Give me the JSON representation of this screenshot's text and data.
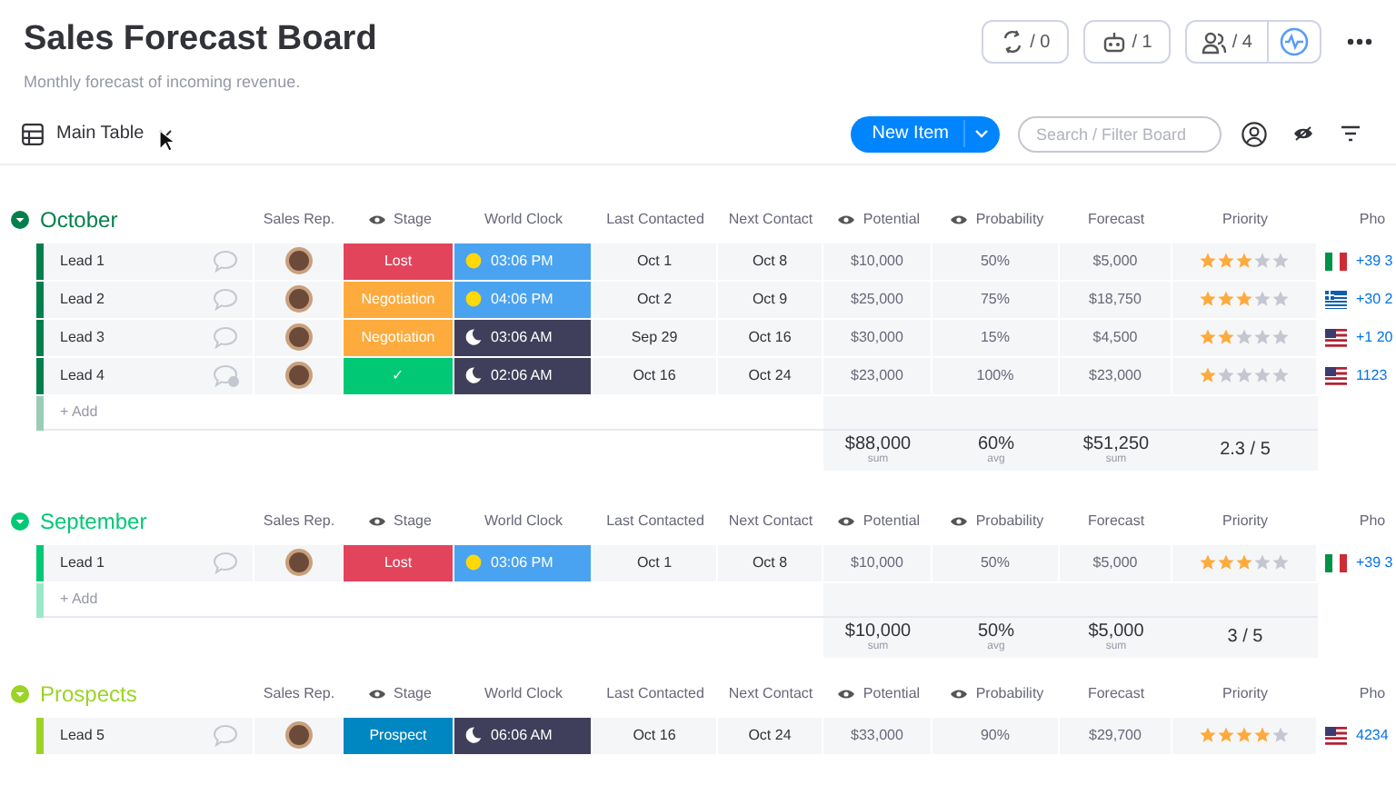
{
  "board": {
    "title": "Sales Forecast Board",
    "description": "Monthly forecast of incoming revenue."
  },
  "header_buttons": [
    {
      "kind": "automations",
      "label": "/ 0"
    },
    {
      "kind": "integrations",
      "label": "/ 1"
    },
    {
      "kind": "members",
      "label": "/ 4"
    }
  ],
  "view": {
    "label": "Main Table"
  },
  "new_item": {
    "label": "New Item"
  },
  "search": {
    "placeholder": "Search / Filter Board"
  },
  "groups": [
    {
      "title": "October",
      "color": "#037f4c",
      "add_label": "+ Add",
      "columns": [
        {
          "label": "Sales Rep.",
          "eye": false
        },
        {
          "label": "Stage",
          "eye": true
        },
        {
          "label": "World Clock",
          "eye": false
        },
        {
          "label": "Last Contacted",
          "eye": false
        },
        {
          "label": "Next Contact",
          "eye": false
        },
        {
          "label": "Potential",
          "eye": true
        },
        {
          "label": "Probability",
          "eye": true
        },
        {
          "label": "Forecast",
          "eye": false
        },
        {
          "label": "Priority",
          "eye": false
        },
        {
          "label": "Pho",
          "eye": false
        }
      ],
      "rows": [
        {
          "name": "Lead 1",
          "has_updates": false,
          "stage": {
            "label": "Lost",
            "color": "#e2445c"
          },
          "clock": {
            "kind": "day",
            "time": "03:06 PM"
          },
          "last_contacted": "Oct 1",
          "next_contact": "Oct 8",
          "potential": "$10,000",
          "probability": "50%",
          "forecast": "$5,000",
          "stars": 3,
          "phone": {
            "kind": "italy",
            "number": "+39 3"
          }
        },
        {
          "name": "Lead 2",
          "has_updates": false,
          "stage": {
            "label": "Negotiation",
            "color": "#fdab3d"
          },
          "clock": {
            "kind": "day",
            "time": "04:06 PM"
          },
          "last_contacted": "Oct 2",
          "next_contact": "Oct 9",
          "potential": "$25,000",
          "probability": "75%",
          "forecast": "$18,750",
          "stars": 3,
          "phone": {
            "kind": "greece",
            "number": "+30 2"
          }
        },
        {
          "name": "Lead 3",
          "has_updates": false,
          "stage": {
            "label": "Negotiation",
            "color": "#fdab3d"
          },
          "clock": {
            "kind": "night",
            "time": "03:06 AM"
          },
          "last_contacted": "Sep 29",
          "next_contact": "Oct 16",
          "potential": "$30,000",
          "probability": "15%",
          "forecast": "$4,500",
          "stars": 2,
          "phone": {
            "kind": "us",
            "number": "+1 20"
          }
        },
        {
          "name": "Lead 4",
          "has_updates": true,
          "stage": {
            "label": "✓",
            "color": "#00c875"
          },
          "clock": {
            "kind": "night",
            "time": "02:06 AM"
          },
          "last_contacted": "Oct 16",
          "next_contact": "Oct 24",
          "potential": "$23,000",
          "probability": "100%",
          "forecast": "$23,000",
          "stars": 1,
          "phone": {
            "kind": "us",
            "number": "1123"
          }
        }
      ],
      "summary": {
        "potential": {
          "value": "$88,000",
          "caption": "sum"
        },
        "probability": {
          "value": "60%",
          "caption": "avg"
        },
        "forecast": {
          "value": "$51,250",
          "caption": "sum"
        },
        "priority": "2.3 / 5"
      }
    },
    {
      "title": "September",
      "color": "#00c875",
      "add_label": "+ Add",
      "columns": [
        {
          "label": "Sales Rep.",
          "eye": false
        },
        {
          "label": "Stage",
          "eye": true
        },
        {
          "label": "World Clock",
          "eye": false
        },
        {
          "label": "Last Contacted",
          "eye": false
        },
        {
          "label": "Next Contact",
          "eye": false
        },
        {
          "label": "Potential",
          "eye": true
        },
        {
          "label": "Probability",
          "eye": true
        },
        {
          "label": "Forecast",
          "eye": false
        },
        {
          "label": "Priority",
          "eye": false
        },
        {
          "label": "Pho",
          "eye": false
        }
      ],
      "rows": [
        {
          "name": "Lead 1",
          "has_updates": false,
          "stage": {
            "label": "Lost",
            "color": "#e2445c"
          },
          "clock": {
            "kind": "day",
            "time": "03:06 PM"
          },
          "last_contacted": "Oct 1",
          "next_contact": "Oct 8",
          "potential": "$10,000",
          "probability": "50%",
          "forecast": "$5,000",
          "stars": 3,
          "phone": {
            "kind": "italy",
            "number": "+39 3"
          }
        }
      ],
      "summary": {
        "potential": {
          "value": "$10,000",
          "caption": "sum"
        },
        "probability": {
          "value": "50%",
          "caption": "avg"
        },
        "forecast": {
          "value": "$5,000",
          "caption": "sum"
        },
        "priority": "3 / 5"
      }
    },
    {
      "title": "Prospects",
      "color": "#9cd326",
      "columns": [
        {
          "label": "Sales Rep.",
          "eye": false
        },
        {
          "label": "Stage",
          "eye": true
        },
        {
          "label": "World Clock",
          "eye": false
        },
        {
          "label": "Last Contacted",
          "eye": false
        },
        {
          "label": "Next Contact",
          "eye": false
        },
        {
          "label": "Potential",
          "eye": true
        },
        {
          "label": "Probability",
          "eye": true
        },
        {
          "label": "Forecast",
          "eye": false
        },
        {
          "label": "Priority",
          "eye": false
        },
        {
          "label": "Pho",
          "eye": false
        }
      ],
      "rows": [
        {
          "name": "Lead 5",
          "has_updates": false,
          "stage": {
            "label": "Prospect",
            "color": "#0086c0"
          },
          "clock": {
            "kind": "night",
            "time": "06:06 AM"
          },
          "last_contacted": "Oct 16",
          "next_contact": "Oct 24",
          "potential": "$33,000",
          "probability": "90%",
          "forecast": "$29,700",
          "stars": 4,
          "phone": {
            "kind": "us",
            "number": "4234"
          }
        }
      ]
    }
  ]
}
